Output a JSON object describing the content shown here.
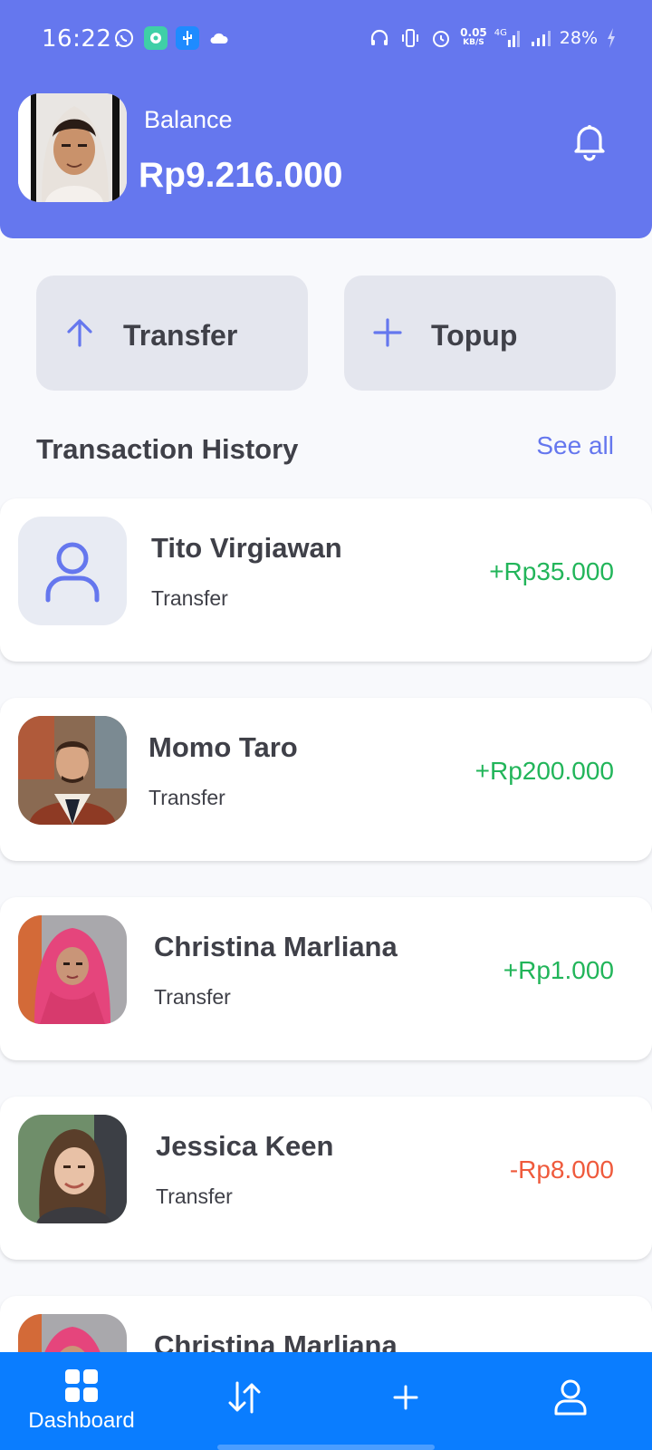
{
  "status_bar": {
    "time": "16:22",
    "net_speed_value": "0.05",
    "net_speed_unit": "KB/S",
    "network": "4G",
    "battery": "28%"
  },
  "header": {
    "balance_label": "Balance",
    "balance_value": "Rp9.216.000"
  },
  "actions": {
    "transfer_label": "Transfer",
    "topup_label": "Topup"
  },
  "history": {
    "title": "Transaction History",
    "see_all": "See all",
    "items": [
      {
        "name": "Tito Virgiawan",
        "type": "Transfer",
        "amount": "+Rp35.000",
        "direction": "in"
      },
      {
        "name": "Momo Taro",
        "type": "Transfer",
        "amount": "+Rp200.000",
        "direction": "in"
      },
      {
        "name": "Christina Marliana",
        "type": "Transfer",
        "amount": "+Rp1.000",
        "direction": "in"
      },
      {
        "name": "Jessica Keen",
        "type": "Transfer",
        "amount": "-Rp8.000",
        "direction": "out"
      },
      {
        "name": "Christina Marliana",
        "type": "",
        "amount": "",
        "direction": "in"
      }
    ]
  },
  "bottom_nav": {
    "dashboard_label": "Dashboard"
  },
  "colors": {
    "primary": "#6577ee",
    "nav": "#0a7dff",
    "positive": "#22b55a",
    "negative": "#ef5a3c"
  }
}
